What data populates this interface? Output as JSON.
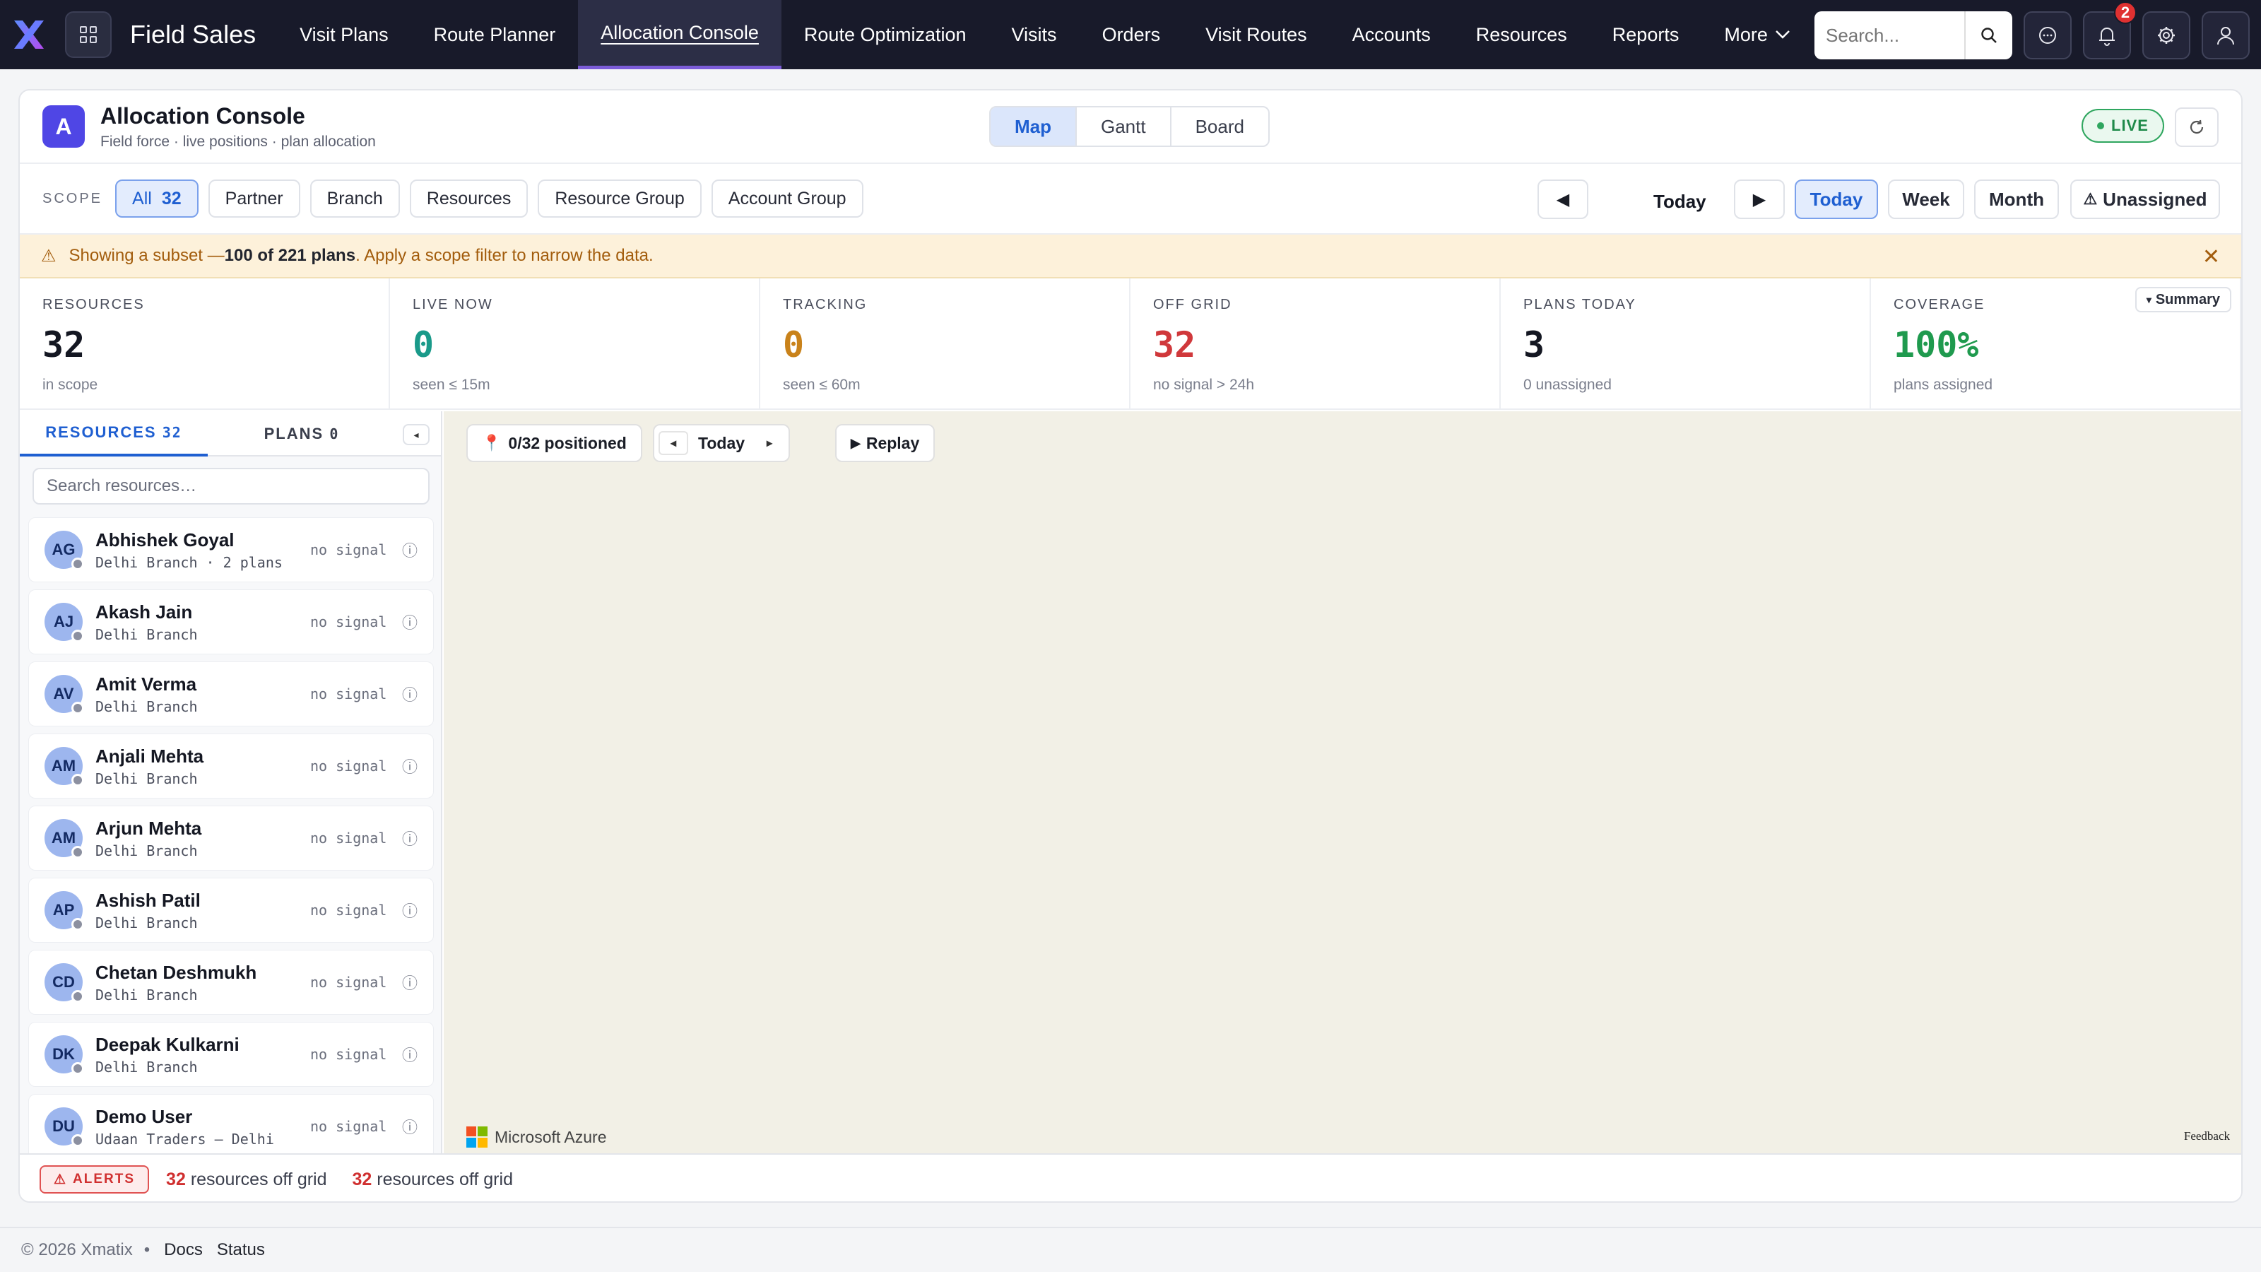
{
  "nav": {
    "app_name": "Field Sales",
    "items": [
      {
        "label": "Visit Plans",
        "active": false
      },
      {
        "label": "Route Planner",
        "active": false
      },
      {
        "label": "Allocation Console",
        "active": true
      },
      {
        "label": "Route Optimization",
        "active": false
      },
      {
        "label": "Visits",
        "active": false
      },
      {
        "label": "Orders",
        "active": false
      },
      {
        "label": "Visit Routes",
        "active": false
      },
      {
        "label": "Accounts",
        "active": false
      },
      {
        "label": "Resources",
        "active": false
      },
      {
        "label": "Reports",
        "active": false
      }
    ],
    "more_label": "More",
    "search_placeholder": "Search...",
    "notification_count": "2"
  },
  "page": {
    "avatar_letter": "A",
    "title": "Allocation Console",
    "subtitle": "Field force · live positions · plan allocation",
    "views": [
      "Map",
      "Gantt",
      "Board"
    ],
    "active_view": "Map",
    "live_label": "LIVE"
  },
  "scope": {
    "label": "SCOPE",
    "all_label": "All",
    "all_count": "32",
    "chips": [
      "Partner",
      "Branch",
      "Resources",
      "Resource Group",
      "Account Group"
    ]
  },
  "date_nav": {
    "prev": "◀",
    "current": "Today",
    "next": "▶",
    "ranges": [
      "Today",
      "Week",
      "Month"
    ],
    "active_range": "Today",
    "unassigned_label": "Unassigned"
  },
  "warning": {
    "prefix": "Showing a subset — ",
    "bold": "100 of 221 plans",
    "suffix": ". Apply a scope filter to narrow the data."
  },
  "stats": [
    {
      "label": "RESOURCES",
      "value": "32",
      "sub": "in scope",
      "color": "#141722"
    },
    {
      "label": "LIVE NOW",
      "value": "0",
      "sub": "seen ≤ 15m",
      "color": "#1a9a8a"
    },
    {
      "label": "TRACKING",
      "value": "0",
      "sub": "seen ≤ 60m",
      "color": "#c9821a"
    },
    {
      "label": "OFF GRID",
      "value": "32",
      "sub": "no signal > 24h",
      "color": "#d0383b"
    },
    {
      "label": "PLANS TODAY",
      "value": "3",
      "sub": "0 unassigned",
      "color": "#141722"
    },
    {
      "label": "COVERAGE",
      "value": "100%",
      "sub": "plans assigned",
      "color": "#1f9a4e"
    }
  ],
  "summary_label": "Summary",
  "left_panel": {
    "resources_tab": "RESOURCES",
    "resources_count": "32",
    "plans_tab": "PLANS",
    "plans_count": "0",
    "search_placeholder": "Search resources…",
    "resources": [
      {
        "initials": "AG",
        "name": "Abhishek Goyal",
        "sub": "Delhi Branch · 2 plans",
        "signal": "no signal"
      },
      {
        "initials": "AJ",
        "name": "Akash Jain",
        "sub": "Delhi Branch",
        "signal": "no signal"
      },
      {
        "initials": "AV",
        "name": "Amit Verma",
        "sub": "Delhi Branch",
        "signal": "no signal"
      },
      {
        "initials": "AM",
        "name": "Anjali Mehta",
        "sub": "Delhi Branch",
        "signal": "no signal"
      },
      {
        "initials": "AM",
        "name": "Arjun Mehta",
        "sub": "Delhi Branch",
        "signal": "no signal"
      },
      {
        "initials": "AP",
        "name": "Ashish Patil",
        "sub": "Delhi Branch",
        "signal": "no signal"
      },
      {
        "initials": "CD",
        "name": "Chetan Deshmukh",
        "sub": "Delhi Branch",
        "signal": "no signal"
      },
      {
        "initials": "DK",
        "name": "Deepak Kulkarni",
        "sub": "Delhi Branch",
        "signal": "no signal"
      },
      {
        "initials": "DU",
        "name": "Demo User",
        "sub": "Udaan Traders — Delhi",
        "signal": "no signal"
      }
    ]
  },
  "map": {
    "positioned_label": "0/32 positioned",
    "day_label": "Today",
    "replay_label": "Replay",
    "provider": "Microsoft Azure",
    "feedback": "Feedback"
  },
  "alerts": {
    "badge": "ALERTS",
    "messages": [
      {
        "count": "32",
        "text": "resources off grid"
      },
      {
        "count": "32",
        "text": "resources off grid"
      }
    ]
  },
  "footer": {
    "copyright": "© 2026 Xmatix",
    "sep": "•",
    "links": [
      "Docs",
      "Status"
    ]
  }
}
